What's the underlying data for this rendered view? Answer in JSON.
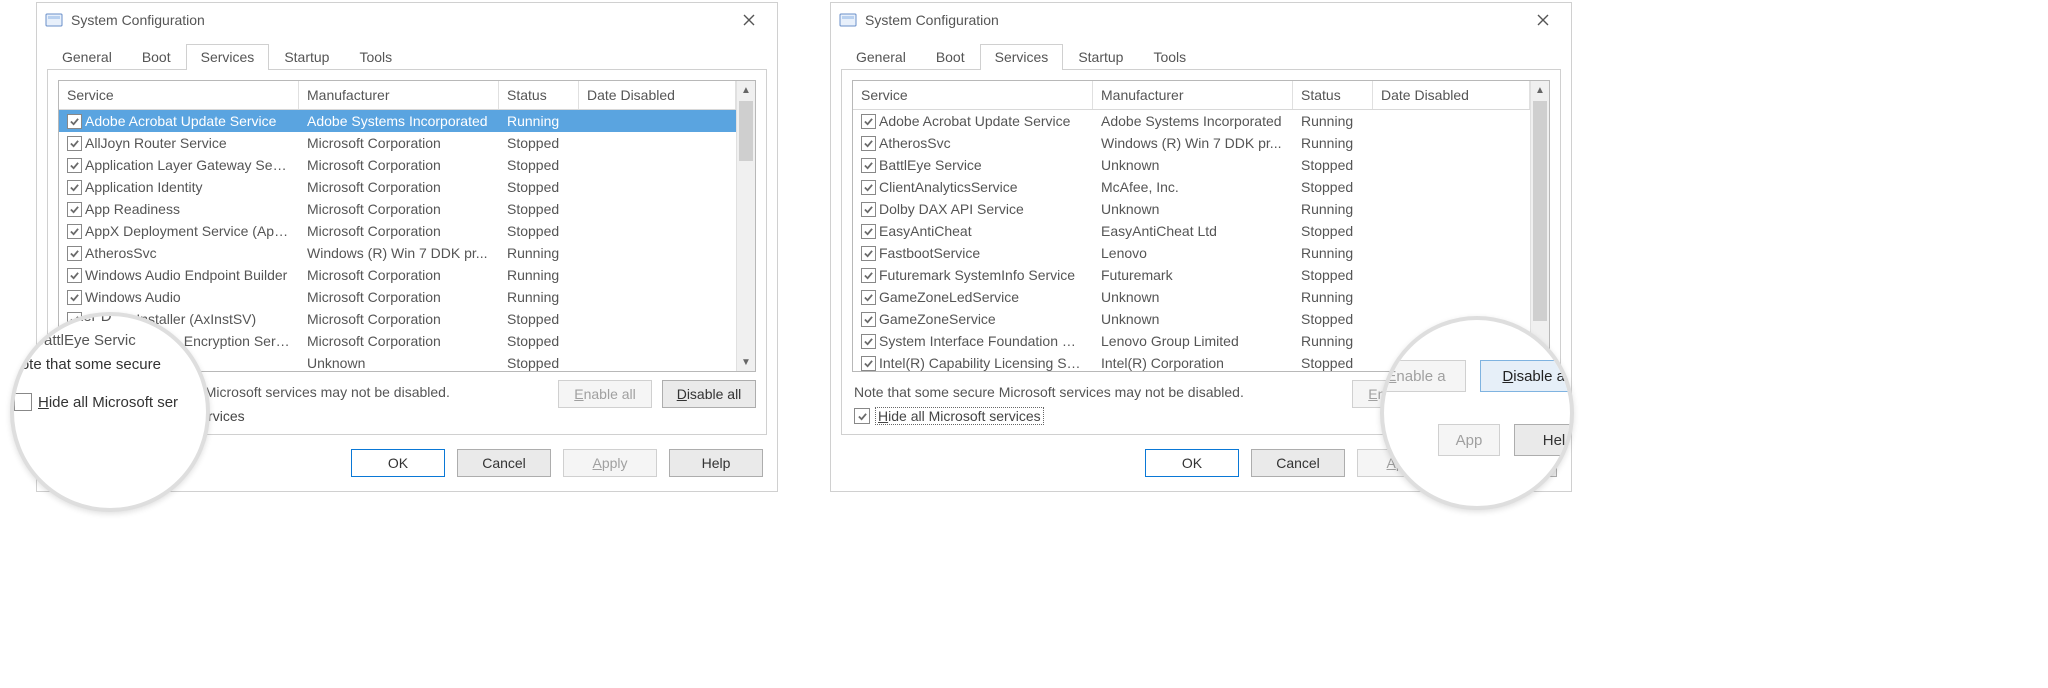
{
  "dialogs": [
    {
      "title": "System Configuration"
    },
    {
      "title": "System Configuration"
    }
  ],
  "tabs": [
    "General",
    "Boot",
    "Services",
    "Startup",
    "Tools"
  ],
  "columns": [
    "Service",
    "Manufacturer",
    "Status",
    "Date Disabled"
  ],
  "note": "Note that some secure Microsoft services may not be disabled.",
  "hide_label_u": "H",
  "hide_label_rest": "ide all Microsoft services",
  "buttons": {
    "enable_u": "E",
    "enable_rest": "nable all",
    "disable_u": "D",
    "disable_rest": "isable all",
    "ok": "OK",
    "cancel": "Cancel",
    "apply_u": "A",
    "apply_rest": "pply",
    "help": "Help"
  },
  "services_left": [
    {
      "checked": true,
      "selected": true,
      "name": "Adobe Acrobat Update Service",
      "manufacturer": "Adobe Systems Incorporated",
      "status": "Running"
    },
    {
      "checked": true,
      "name": "AllJoyn Router Service",
      "manufacturer": "Microsoft Corporation",
      "status": "Stopped"
    },
    {
      "checked": true,
      "name": "Application Layer Gateway Service",
      "manufacturer": "Microsoft Corporation",
      "status": "Stopped"
    },
    {
      "checked": true,
      "name": "Application Identity",
      "manufacturer": "Microsoft Corporation",
      "status": "Stopped"
    },
    {
      "checked": true,
      "name": "App Readiness",
      "manufacturer": "Microsoft Corporation",
      "status": "Stopped"
    },
    {
      "checked": true,
      "name": "AppX Deployment Service (AppX...",
      "manufacturer": "Microsoft Corporation",
      "status": "Stopped"
    },
    {
      "checked": true,
      "name": "AtherosSvc",
      "manufacturer": "Windows (R) Win 7 DDK pr...",
      "status": "Running"
    },
    {
      "checked": true,
      "name": "Windows Audio Endpoint Builder",
      "manufacturer": "Microsoft Corporation",
      "status": "Running"
    },
    {
      "checked": true,
      "name": "Windows Audio",
      "manufacturer": "Microsoft Corporation",
      "status": "Running"
    },
    {
      "checked": true,
      "name": "ActiveX Installer (AxInstSV)",
      "manufacturer": "Microsoft Corporation",
      "status": "Stopped"
    },
    {
      "checked": true,
      "name": "BitLocker Drive Encryption Service",
      "manufacturer": "Microsoft Corporation",
      "status": "Stopped"
    },
    {
      "checked": true,
      "name": "BattlEye Service",
      "manufacturer": "Unknown",
      "status": "Stopped"
    }
  ],
  "services_right": [
    {
      "checked": true,
      "name": "Adobe Acrobat Update Service",
      "manufacturer": "Adobe Systems Incorporated",
      "status": "Running"
    },
    {
      "checked": true,
      "name": "AtherosSvc",
      "manufacturer": "Windows (R) Win 7 DDK pr...",
      "status": "Running"
    },
    {
      "checked": true,
      "name": "BattlEye Service",
      "manufacturer": "Unknown",
      "status": "Stopped"
    },
    {
      "checked": true,
      "name": "ClientAnalyticsService",
      "manufacturer": "McAfee, Inc.",
      "status": "Stopped"
    },
    {
      "checked": true,
      "name": "Dolby DAX API Service",
      "manufacturer": "Unknown",
      "status": "Running"
    },
    {
      "checked": true,
      "name": "EasyAntiCheat",
      "manufacturer": "EasyAntiCheat Ltd",
      "status": "Stopped"
    },
    {
      "checked": true,
      "name": "FastbootService",
      "manufacturer": "Lenovo",
      "status": "Running"
    },
    {
      "checked": true,
      "name": "Futuremark SystemInfo Service",
      "manufacturer": "Futuremark",
      "status": "Stopped"
    },
    {
      "checked": true,
      "name": "GameZoneLedService",
      "manufacturer": "Unknown",
      "status": "Running"
    },
    {
      "checked": true,
      "name": "GameZoneService",
      "manufacturer": "Unknown",
      "status": "Stopped"
    },
    {
      "checked": true,
      "name": "System Interface Foundation Se...",
      "manufacturer": "Lenovo Group Limited",
      "status": "Running"
    },
    {
      "checked": true,
      "name": "Intel(R) Capability Licensing Ser...",
      "manufacturer": "Intel(R) Corporation",
      "status": "Stopped"
    }
  ],
  "magnifier_left": {
    "rows": [
      "BitLocker D",
      "BattlEye Servic"
    ],
    "note": "Note that some secure",
    "hide_rest": "ide all Microsoft ser"
  },
  "magnifier_right": {
    "enable_u": "E",
    "enable_rest": "nable a",
    "apply_short": "App",
    "help_short": "Hel"
  }
}
